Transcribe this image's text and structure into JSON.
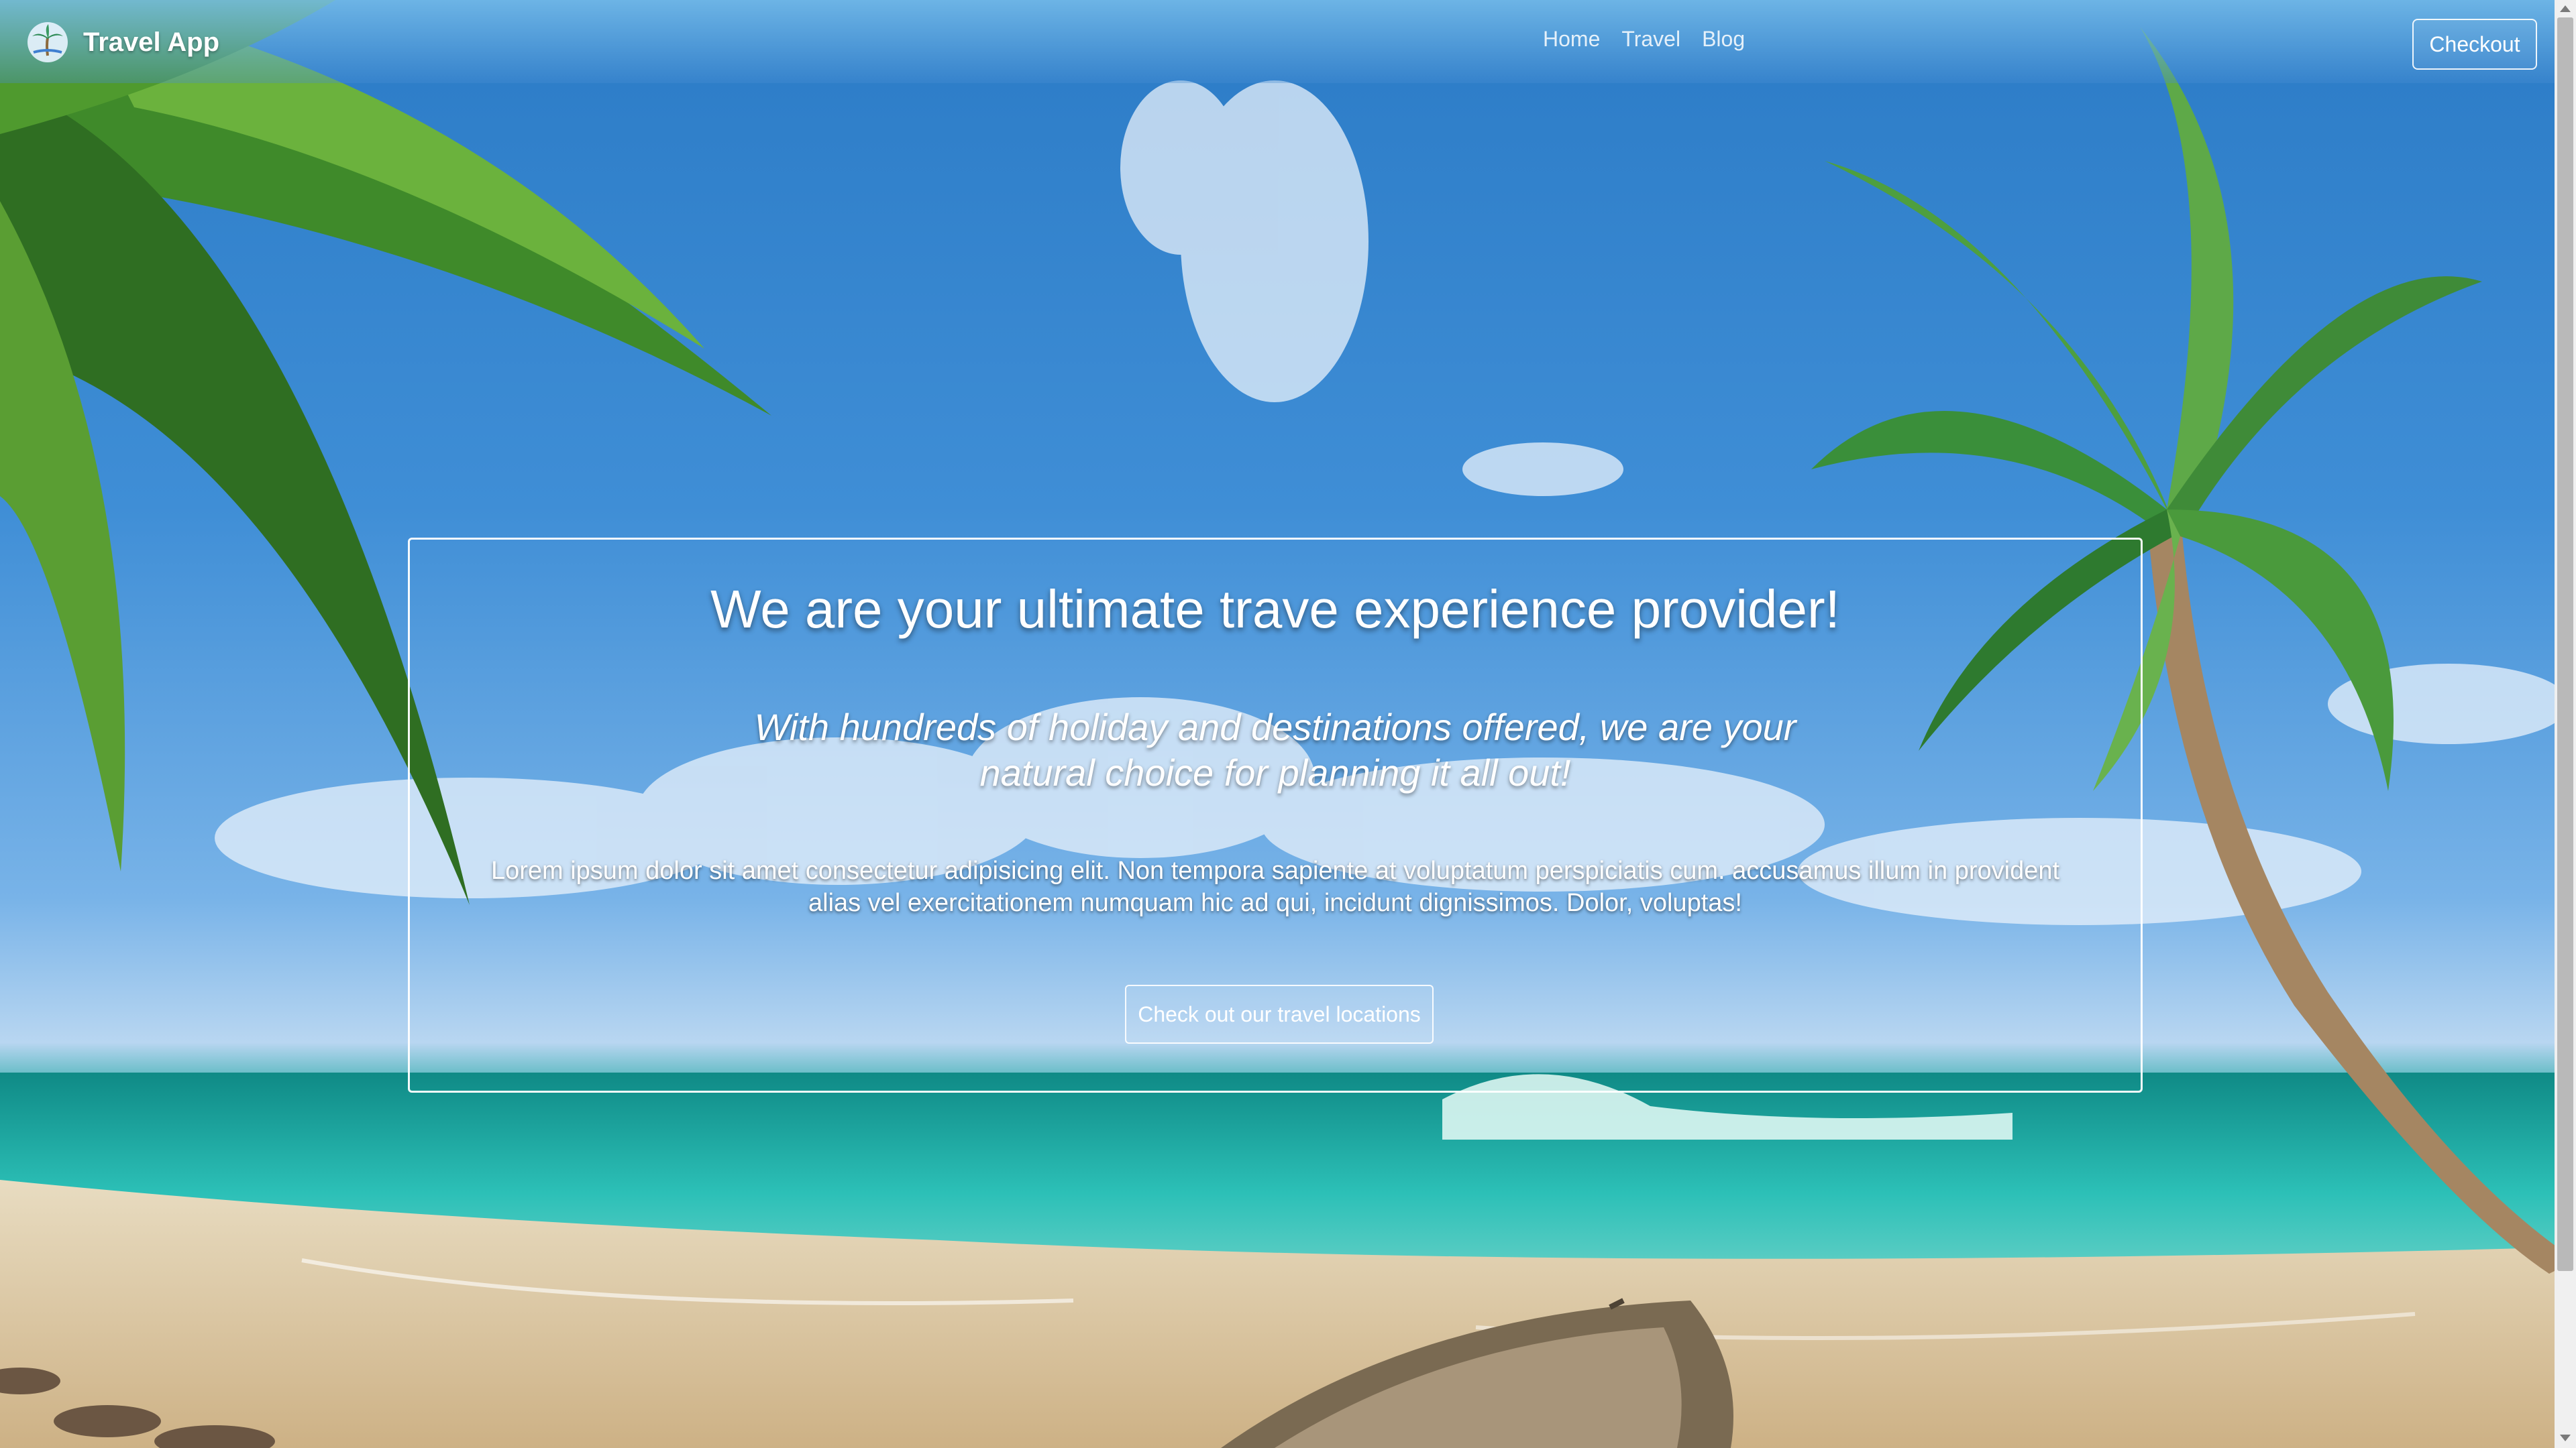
{
  "navbar": {
    "brand": "Travel App",
    "links": [
      "Home",
      "Travel",
      "Blog"
    ],
    "checkout_label": "Checkout"
  },
  "hero": {
    "title": "We are your ultimate trave experience provider!",
    "subtitle": "With hundreds of holiday and destinations offered, we are your natural choice for planning it all out!",
    "body": "Lorem ipsum dolor sit amet consectetur adipisicing elit. Non tempora sapiente at voluptatum perspiciatis cum. accusamus illum in provident alias vel exercitationem numquam hic ad qui, incidunt dignissimos. Dolor, voluptas!",
    "cta_label": "Check out our travel locations"
  },
  "icons": {
    "brand_logo": "palm-tree-logo-icon",
    "scroll_up": "arrow-up-icon",
    "scroll_down": "arrow-down-icon"
  },
  "colors": {
    "text": "#ffffff",
    "sky": "#2b7bc6",
    "sea": "#2fc0b8",
    "sand": "#d6bd8c"
  }
}
